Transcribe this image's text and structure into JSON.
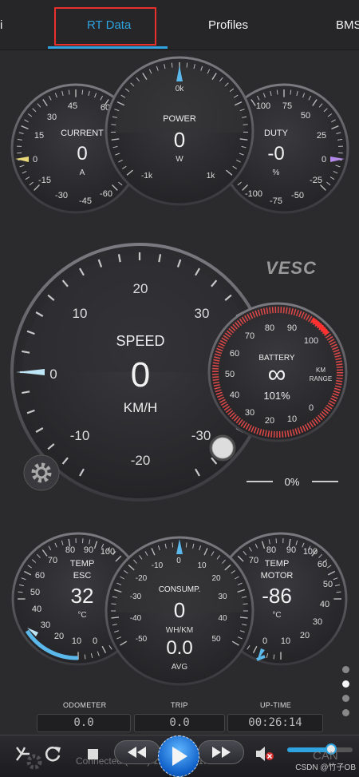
{
  "tabs": [
    "i",
    "RT Data",
    "Profiles",
    "BMS"
  ],
  "gauges": {
    "current": {
      "title": "CURRENT",
      "value": "0",
      "unit": "A",
      "ticks": [
        "45",
        "60",
        "30",
        "15",
        "0",
        "-15",
        "-30",
        "-45",
        "-60"
      ]
    },
    "power": {
      "title": "POWER",
      "value": "0",
      "unit": "W",
      "ticks": [
        "0k",
        "-1k",
        "1k"
      ]
    },
    "duty": {
      "title": "DUTY",
      "value": "-0",
      "unit": "%",
      "ticks": [
        "100",
        "75",
        "50",
        "25",
        "0",
        "-25",
        "-50",
        "-75",
        "-100"
      ]
    },
    "speed": {
      "title": "SPEED",
      "value": "0",
      "unit": "KM/H",
      "ticks": [
        "20",
        "10",
        "30",
        "0",
        "-10",
        "-30",
        "-20"
      ]
    },
    "battery": {
      "title": "BATTERY",
      "value": "∞",
      "percent": "101%",
      "range_label_1": "KM",
      "range_label_2": "RANGE",
      "ticks": [
        "70",
        "80",
        "90",
        "100",
        "60",
        "50",
        "40",
        "30",
        "20",
        "10",
        "0"
      ]
    },
    "temp_esc": {
      "title_1": "TEMP",
      "title_2": "ESC",
      "value": "32",
      "unit": "°C",
      "ticks": [
        "80",
        "90",
        "100",
        "70",
        "60",
        "50",
        "40",
        "30",
        "20",
        "10",
        "0"
      ]
    },
    "consumption": {
      "title": "CONSUMP.",
      "value": "0",
      "unit": "WH/KM",
      "avg_value": "0.0",
      "avg_label": "AVG",
      "ticks": [
        "0",
        "-10",
        "10",
        "-20",
        "20",
        "-30",
        "30",
        "-40",
        "40",
        "-50",
        "50"
      ]
    },
    "temp_motor": {
      "title_1": "TEMP",
      "title_2": "MOTOR",
      "value": "-86",
      "unit": "°C",
      "ticks": [
        "80",
        "90",
        "100",
        "70",
        "60",
        "50",
        "40",
        "30",
        "20",
        "10",
        "0"
      ]
    }
  },
  "logo": "VESC",
  "throttle_percent": "0%",
  "stats": {
    "odometer_label": "ODOMETER",
    "odometer_value": "0.0",
    "trip_label": "TRIP",
    "trip_value": "0.0",
    "uptime_label": "UP-TIME",
    "uptime_value": "00:26:14"
  },
  "status": "Connected (TCP) 192.168.4.1:65102",
  "can_label": "CAN",
  "watermark": "CSDN @竹子OB",
  "colors": {
    "accent": "#2fa3df",
    "battery_red": "#e04848",
    "current_needle": "#e8d87a",
    "duty_needle": "#b48ae8"
  }
}
